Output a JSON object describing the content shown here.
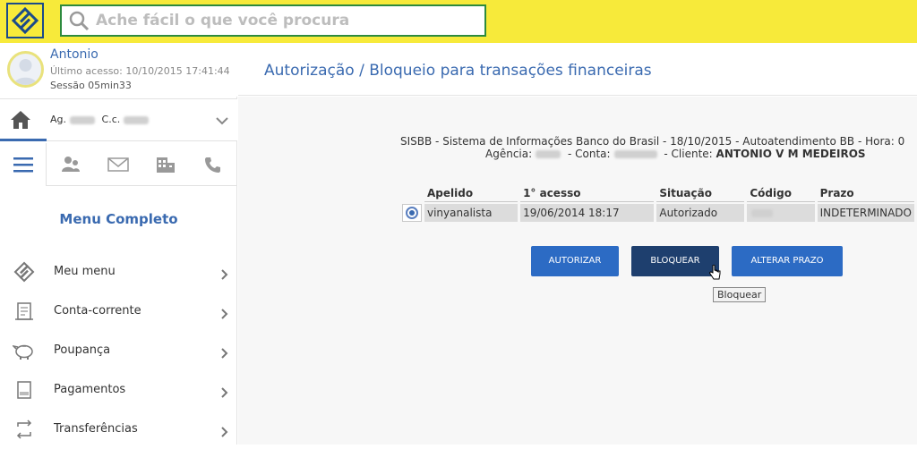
{
  "search": {
    "placeholder": "Ache fácil o que você procura"
  },
  "user": {
    "name": "Antonio",
    "last_access": "Último acesso: 10/10/2015 17:41:44",
    "session": "Sessão 05min33"
  },
  "account": {
    "ag_label": "Ag.",
    "cc_label": "C.c."
  },
  "menu": {
    "title": "Menu Completo",
    "items": [
      {
        "label": "Meu menu",
        "icon": "bb-logo-icon"
      },
      {
        "label": "Conta-corrente",
        "icon": "statement-icon"
      },
      {
        "label": "Poupança",
        "icon": "piggy-bank-icon"
      },
      {
        "label": "Pagamentos",
        "icon": "barcode-icon"
      },
      {
        "label": "Transferências",
        "icon": "transfer-icon"
      }
    ]
  },
  "page": {
    "title": "Autorização / Bloqueio para transações financeiras"
  },
  "info": {
    "line1": "SISBB - Sistema de Informações Banco do Brasil - 18/10/2015 - Autoatendimento BB - Hora: 0",
    "agencia_label": "Agência:",
    "conta_label": "- Conta:",
    "cliente_label": "- Cliente:",
    "cliente_name": "ANTONIO V M MEDEIROS"
  },
  "table": {
    "headers": [
      "Apelido",
      "1° acesso",
      "Situação",
      "Código",
      "Prazo"
    ],
    "rows": [
      {
        "apelido": "vinyanalista",
        "acesso": "19/06/2014 18:17",
        "situacao": "Autorizado",
        "codigo": "",
        "prazo": "INDETERMINADO"
      }
    ]
  },
  "buttons": {
    "autorizar": "AUTORIZAR",
    "bloquear": "BLOQUEAR",
    "alterar_prazo": "ALTERAR PRAZO"
  },
  "tooltip": "Bloquear",
  "colors": {
    "brand_yellow": "#f7ea3a",
    "brand_blue": "#3a6ab0",
    "button_blue": "#2c6bc4",
    "button_active": "#1e3f6e"
  }
}
